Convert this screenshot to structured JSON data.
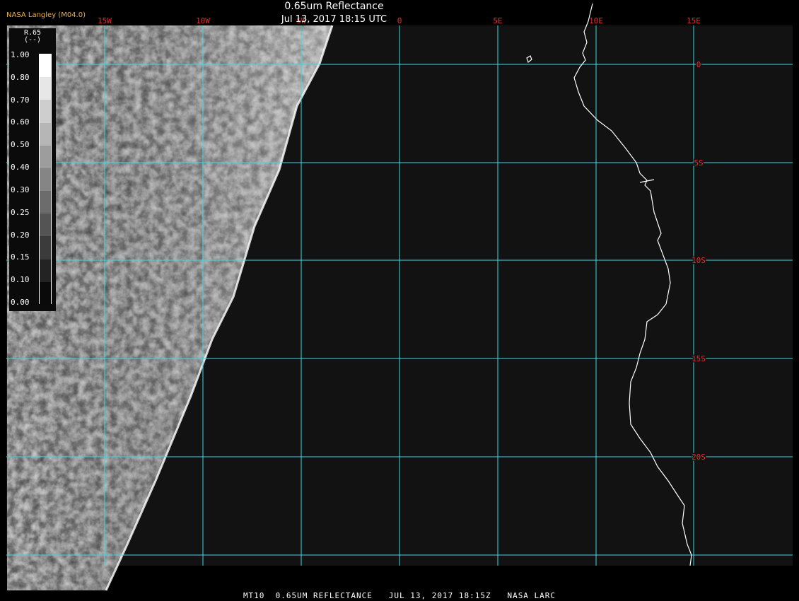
{
  "title_line1": "0.65um Reflectance",
  "title_line2": "Jul 13, 2017 18:15 UTC",
  "credit": "NASA Langley (M04.0)",
  "footer": "MT10  0.65UM REFLECTANCE   JUL 13, 2017 18:15Z   NASA LARC",
  "legend": {
    "label": "R.65\n(--)",
    "ticks": [
      "1.00",
      "0.80",
      "0.70",
      "0.60",
      "0.50",
      "0.40",
      "0.30",
      "0.25",
      "0.20",
      "0.15",
      "0.10",
      "0.00"
    ]
  },
  "grid": {
    "lon_labels": [
      "15W",
      "10W",
      "5W",
      "0",
      "5E",
      "10E",
      "15E"
    ],
    "lat_labels": [
      "0",
      "5S",
      "10S",
      "15S",
      "20S"
    ],
    "line_color": "#40d8e0",
    "label_color": "#e03030"
  },
  "colors": {
    "ocean": "#121212",
    "coastline": "#ffffff",
    "cloud": "#d0d0d0"
  }
}
